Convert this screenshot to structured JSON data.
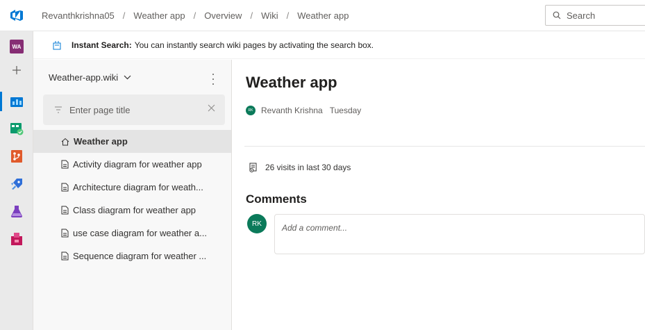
{
  "breadcrumb": [
    "Revanthkrishna05",
    "Weather app",
    "Overview",
    "Wiki",
    "Weather app"
  ],
  "search": {
    "placeholder": "Search"
  },
  "rail": {
    "project_initials": "WA"
  },
  "banner": {
    "bold": "Instant Search:",
    "text": "You can instantly search wiki pages by activating the search box."
  },
  "wiki": {
    "name": "Weather-app.wiki",
    "filter_placeholder": "Enter page title",
    "pages": [
      {
        "label": "Weather app",
        "icon": "home-icon",
        "selected": true
      },
      {
        "label": "Activity diagram for weather app",
        "icon": "page-icon",
        "selected": false
      },
      {
        "label": "Architecture diagram for weath...",
        "icon": "page-icon",
        "selected": false
      },
      {
        "label": "Class diagram for weather app",
        "icon": "page-icon",
        "selected": false
      },
      {
        "label": "use case diagram for weather a...",
        "icon": "page-icon",
        "selected": false
      },
      {
        "label": "Sequence diagram for weather ...",
        "icon": "page-icon",
        "selected": false
      }
    ]
  },
  "page": {
    "title": "Weather app",
    "author_initials": "RK",
    "author": "Revanth Krishna",
    "date": "Tuesday",
    "visits": "26 visits in last 30 days",
    "comments_title": "Comments",
    "commenter_initials": "RK",
    "comment_placeholder": "Add a comment..."
  },
  "colors": {
    "accent": "#0078d4",
    "avatar": "#0b7a5a",
    "project_badge": "#862d74"
  }
}
